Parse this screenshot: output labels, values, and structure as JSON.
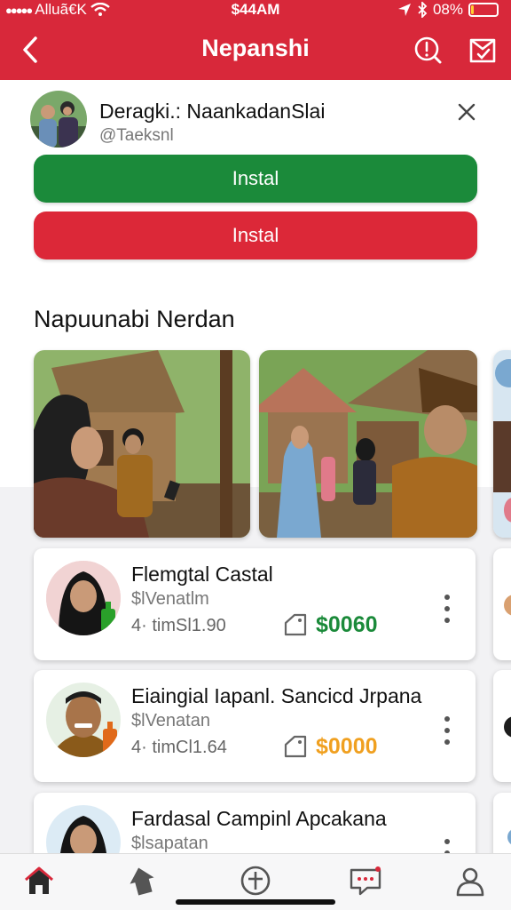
{
  "status_bar": {
    "carrier": "Alluã€K",
    "time": "$44AM",
    "battery": "08%",
    "battery_level": 0.12,
    "icons": [
      "signal-dots-icon",
      "wifi-icon",
      "location-icon",
      "bluetooth-icon",
      "battery-icon"
    ]
  },
  "header": {
    "title": "Nepanshi",
    "icons": [
      "back-chevron-icon",
      "alert-icon",
      "compose-icon"
    ]
  },
  "install_banner": {
    "title": "Deragki.: NaankadanSlai",
    "handle": "@Taeksnl",
    "primary_button": "Instal",
    "secondary_button": "Instal",
    "colors": {
      "primary": "#1b8a3a",
      "secondary": "#dc2838"
    }
  },
  "section": {
    "title": "Napuunabi Nerdan"
  },
  "listings": [
    {
      "title": "Flemgtal  Castal",
      "subtitle": "$lVenatlm",
      "meta": "4· timSl1.90",
      "price": "$0060",
      "price_color": "#1b8a3a"
    },
    {
      "title": "Eiaingial  Iapanl. Sancicd Jrpana",
      "subtitle": "$lVenatan",
      "meta": "4· timCl1.64",
      "price": "$0000",
      "price_color": "#f0a020"
    },
    {
      "title": "Fardasal Campinl Apcakana",
      "subtitle": "$lsapatan"
    }
  ],
  "tab_bar": {
    "icons": [
      "home-icon",
      "tag-icon",
      "create-icon",
      "messages-icon",
      "profile-icon"
    ]
  },
  "colors": {
    "brand": "#d8283a"
  }
}
